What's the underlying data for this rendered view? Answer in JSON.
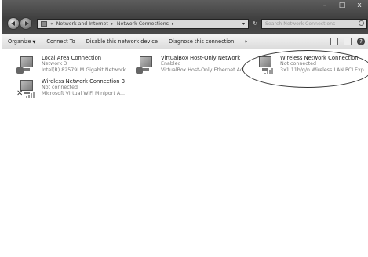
{
  "window_controls": {
    "minimize": "–",
    "maximize": "□",
    "close": "x"
  },
  "address_bar": {
    "prefix": "«",
    "crumb1": "Network and Internet",
    "sep1": "▸",
    "crumb2": "Network Connections",
    "sep2": "▸",
    "dropdown": "▾"
  },
  "refresh": "↻",
  "search": {
    "placeholder": "Search Network Connections"
  },
  "toolbar": {
    "organize": "Organize",
    "organize_arrow": "▼",
    "connect_to": "Connect To",
    "disable": "Disable this network device",
    "diagnose": "Diagnose this connection",
    "more": "»",
    "help": "?"
  },
  "connections": [
    {
      "name": "Local Area Connection",
      "status": "Network 3",
      "device": "Intel(R) 82579LM Gigabit Network..."
    },
    {
      "name": "VirtualBox Host-Only Network",
      "status": "Enabled",
      "device": "VirtualBox Host-Only Ethernet Ad..."
    },
    {
      "name": "Wireless Network Connection",
      "status": "Not connected",
      "device": "3x1 11b/g/n Wireless LAN PCI Exp..."
    },
    {
      "name": "Wireless Network Connection 3",
      "status": "Not connected",
      "device": "Microsoft Virtual WiFi Miniport A..."
    }
  ],
  "icons": {
    "back": "back-arrow-icon",
    "forward": "forward-arrow-icon",
    "network_adapter": "network-adapter-icon",
    "disconnected": "x-mark-icon"
  }
}
